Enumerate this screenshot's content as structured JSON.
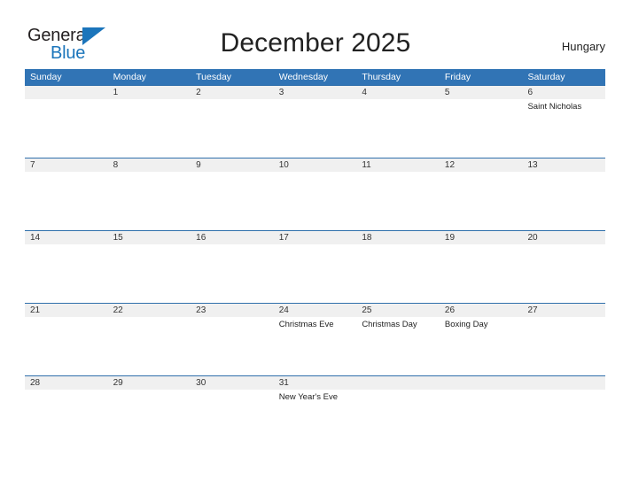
{
  "brand": {
    "name_part1": "General",
    "name_part2": "Blue",
    "triangle_color": "#1b75bb"
  },
  "header": {
    "title": "December 2025",
    "region": "Hungary",
    "header_bg_color": "#3174b5",
    "row_band_color": "#f0f0f0"
  },
  "weekdays": [
    "Sunday",
    "Monday",
    "Tuesday",
    "Wednesday",
    "Thursday",
    "Friday",
    "Saturday"
  ],
  "weeks": [
    {
      "days": [
        {
          "num": "",
          "event": ""
        },
        {
          "num": "1",
          "event": ""
        },
        {
          "num": "2",
          "event": ""
        },
        {
          "num": "3",
          "event": ""
        },
        {
          "num": "4",
          "event": ""
        },
        {
          "num": "5",
          "event": ""
        },
        {
          "num": "6",
          "event": "Saint Nicholas"
        }
      ]
    },
    {
      "days": [
        {
          "num": "7",
          "event": ""
        },
        {
          "num": "8",
          "event": ""
        },
        {
          "num": "9",
          "event": ""
        },
        {
          "num": "10",
          "event": ""
        },
        {
          "num": "11",
          "event": ""
        },
        {
          "num": "12",
          "event": ""
        },
        {
          "num": "13",
          "event": ""
        }
      ]
    },
    {
      "days": [
        {
          "num": "14",
          "event": ""
        },
        {
          "num": "15",
          "event": ""
        },
        {
          "num": "16",
          "event": ""
        },
        {
          "num": "17",
          "event": ""
        },
        {
          "num": "18",
          "event": ""
        },
        {
          "num": "19",
          "event": ""
        },
        {
          "num": "20",
          "event": ""
        }
      ]
    },
    {
      "days": [
        {
          "num": "21",
          "event": ""
        },
        {
          "num": "22",
          "event": ""
        },
        {
          "num": "23",
          "event": ""
        },
        {
          "num": "24",
          "event": "Christmas Eve"
        },
        {
          "num": "25",
          "event": "Christmas Day"
        },
        {
          "num": "26",
          "event": "Boxing Day"
        },
        {
          "num": "27",
          "event": ""
        }
      ]
    },
    {
      "days": [
        {
          "num": "28",
          "event": ""
        },
        {
          "num": "29",
          "event": ""
        },
        {
          "num": "30",
          "event": ""
        },
        {
          "num": "31",
          "event": "New Year's Eve"
        },
        {
          "num": "",
          "event": ""
        },
        {
          "num": "",
          "event": ""
        },
        {
          "num": "",
          "event": ""
        }
      ]
    }
  ]
}
